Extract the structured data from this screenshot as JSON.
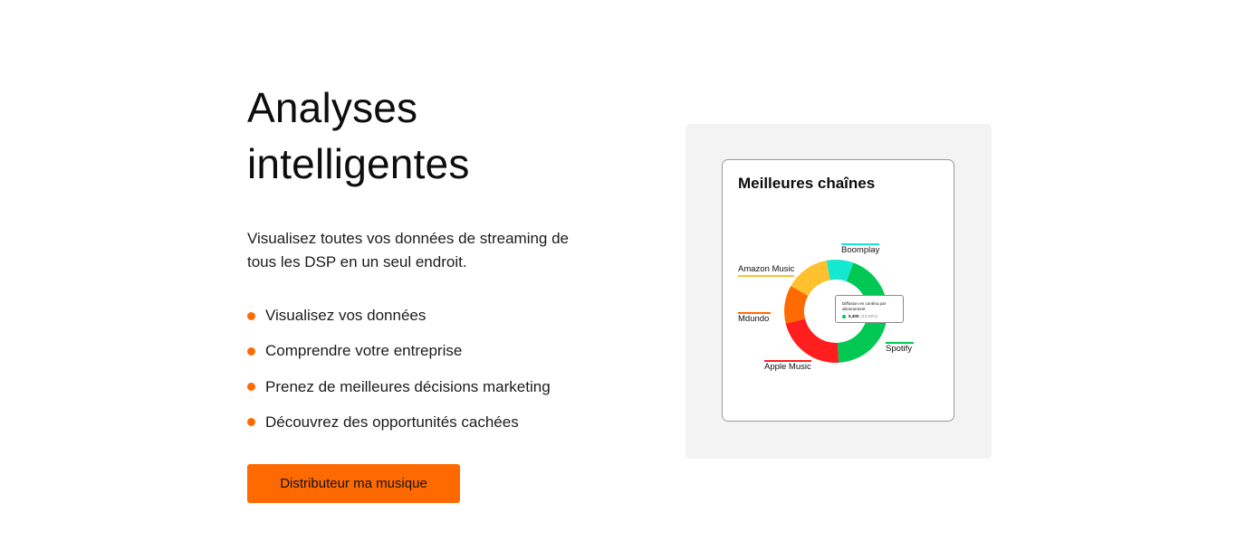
{
  "hero": {
    "title_line1": "Analyses",
    "title_line2": "intelligentes",
    "description": "Visualisez toutes vos données de streaming de tous les DSP en un seul endroit.",
    "features": [
      "Visualisez vos données",
      "Comprendre votre entreprise",
      "Prenez de meilleures décisions marketing",
      "Découvrez des opportunités cachées"
    ],
    "cta_label": "Distributeur ma musique",
    "accent_color": "#ff6a00"
  },
  "card": {
    "title": "Meilleures chaînes",
    "tooltip": {
      "title": "Diffusion en continu par abonnement",
      "value": "5,300",
      "percent": "(43.63%)"
    }
  },
  "chart_data": {
    "type": "pie",
    "donut": true,
    "title": "Meilleures chaînes",
    "categories": [
      "Spotify",
      "Apple Music",
      "Mdundo",
      "Amazon Music",
      "Boomplay"
    ],
    "values": [
      43.63,
      22,
      12,
      14,
      8.37
    ],
    "colors": [
      "#00c853",
      "#ff1e1e",
      "#ff6b00",
      "#ffc12e",
      "#14e8d0"
    ]
  }
}
